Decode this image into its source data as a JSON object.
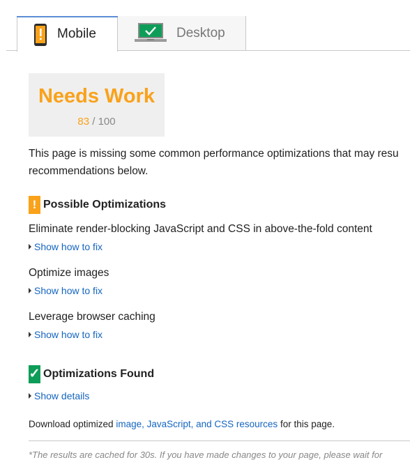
{
  "tabs": [
    {
      "label": "Mobile",
      "icon": "phone-icon",
      "selected": true
    },
    {
      "label": "Desktop",
      "icon": "laptop-check-icon",
      "selected": false
    }
  ],
  "score": {
    "title": "Needs Work",
    "value": "83",
    "separator": " / ",
    "max": "100",
    "color": "#f9a21a"
  },
  "summary": {
    "line1": "This page is missing some common performance optimizations that may resu",
    "line2": "recommendations below."
  },
  "possible": {
    "title": "Possible Optimizations",
    "badge": "!",
    "color": "#f9a21a",
    "rules": [
      {
        "title": "Eliminate render-blocking JavaScript and CSS in above-the-fold content",
        "link": "Show how to fix"
      },
      {
        "title": "Optimize images",
        "link": "Show how to fix"
      },
      {
        "title": "Leverage browser caching",
        "link": "Show how to fix"
      }
    ]
  },
  "found": {
    "title": "Optimizations Found",
    "badge": "✓",
    "color": "#0e9d58",
    "link": "Show details"
  },
  "download": {
    "prefix": "Download optimized ",
    "link": "image, JavaScript, and CSS resources",
    "suffix": " for this page."
  },
  "footnote": "*The results are cached for 30s. If you have made changes to your page, please wait for"
}
